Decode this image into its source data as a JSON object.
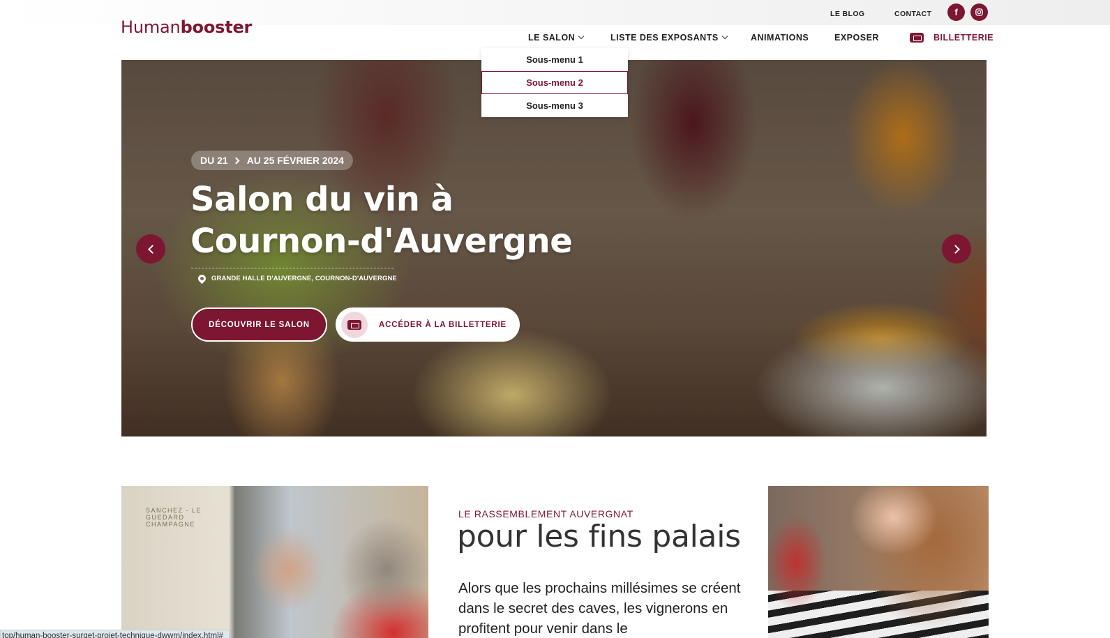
{
  "topbar": {
    "blog": "LE BLOG",
    "contact": "CONTACT",
    "social": [
      {
        "name": "facebook",
        "glyph": "f"
      },
      {
        "name": "instagram",
        "glyph": ""
      }
    ]
  },
  "logo": {
    "part1": "Human",
    "part2": "booster"
  },
  "nav": {
    "items": [
      {
        "label": "LE SALON",
        "dropdown": true
      },
      {
        "label": "LISTE DES EXPOSANTS",
        "dropdown": true
      },
      {
        "label": "ANIMATIONS"
      },
      {
        "label": "EXPOSER"
      }
    ],
    "ticket": "BILLETTERIE"
  },
  "dropdown": {
    "items": [
      "Sous-menu 1",
      "Sous-menu 2",
      "Sous-menu 3"
    ],
    "active_index": 1
  },
  "hero": {
    "date_from": "DU 21",
    "date_to": "AU 25 FÉVRIER 2024",
    "title_line1": "Salon du vin à",
    "title_line2": "Cournon-d'Auvergne",
    "location": "GRANDE HALLE D'AUVERGNE, COURNON-D'AUVERGNE",
    "cta_primary": "DÉCOUVRIR LE SALON",
    "cta_secondary": "ACCÉDER À LA BILLETTERIE"
  },
  "intro": {
    "kicker": "LE RASSEMBLEMENT AUVERGNAT",
    "title": "pour les fins palais",
    "body": "Alors que les prochains millésimes se créent dans le secret des caves, les vignerons en profitent pour venir dans le"
  },
  "left_image": {
    "sign": "SANCHEZ - LE GUEDARD CHAMPAGNE"
  },
  "statusbar": {
    "url": "top/human-booster-surget-projet-technique-dwwm/index.html#"
  },
  "colors": {
    "brand": "#7d1631",
    "text": "#222222"
  }
}
